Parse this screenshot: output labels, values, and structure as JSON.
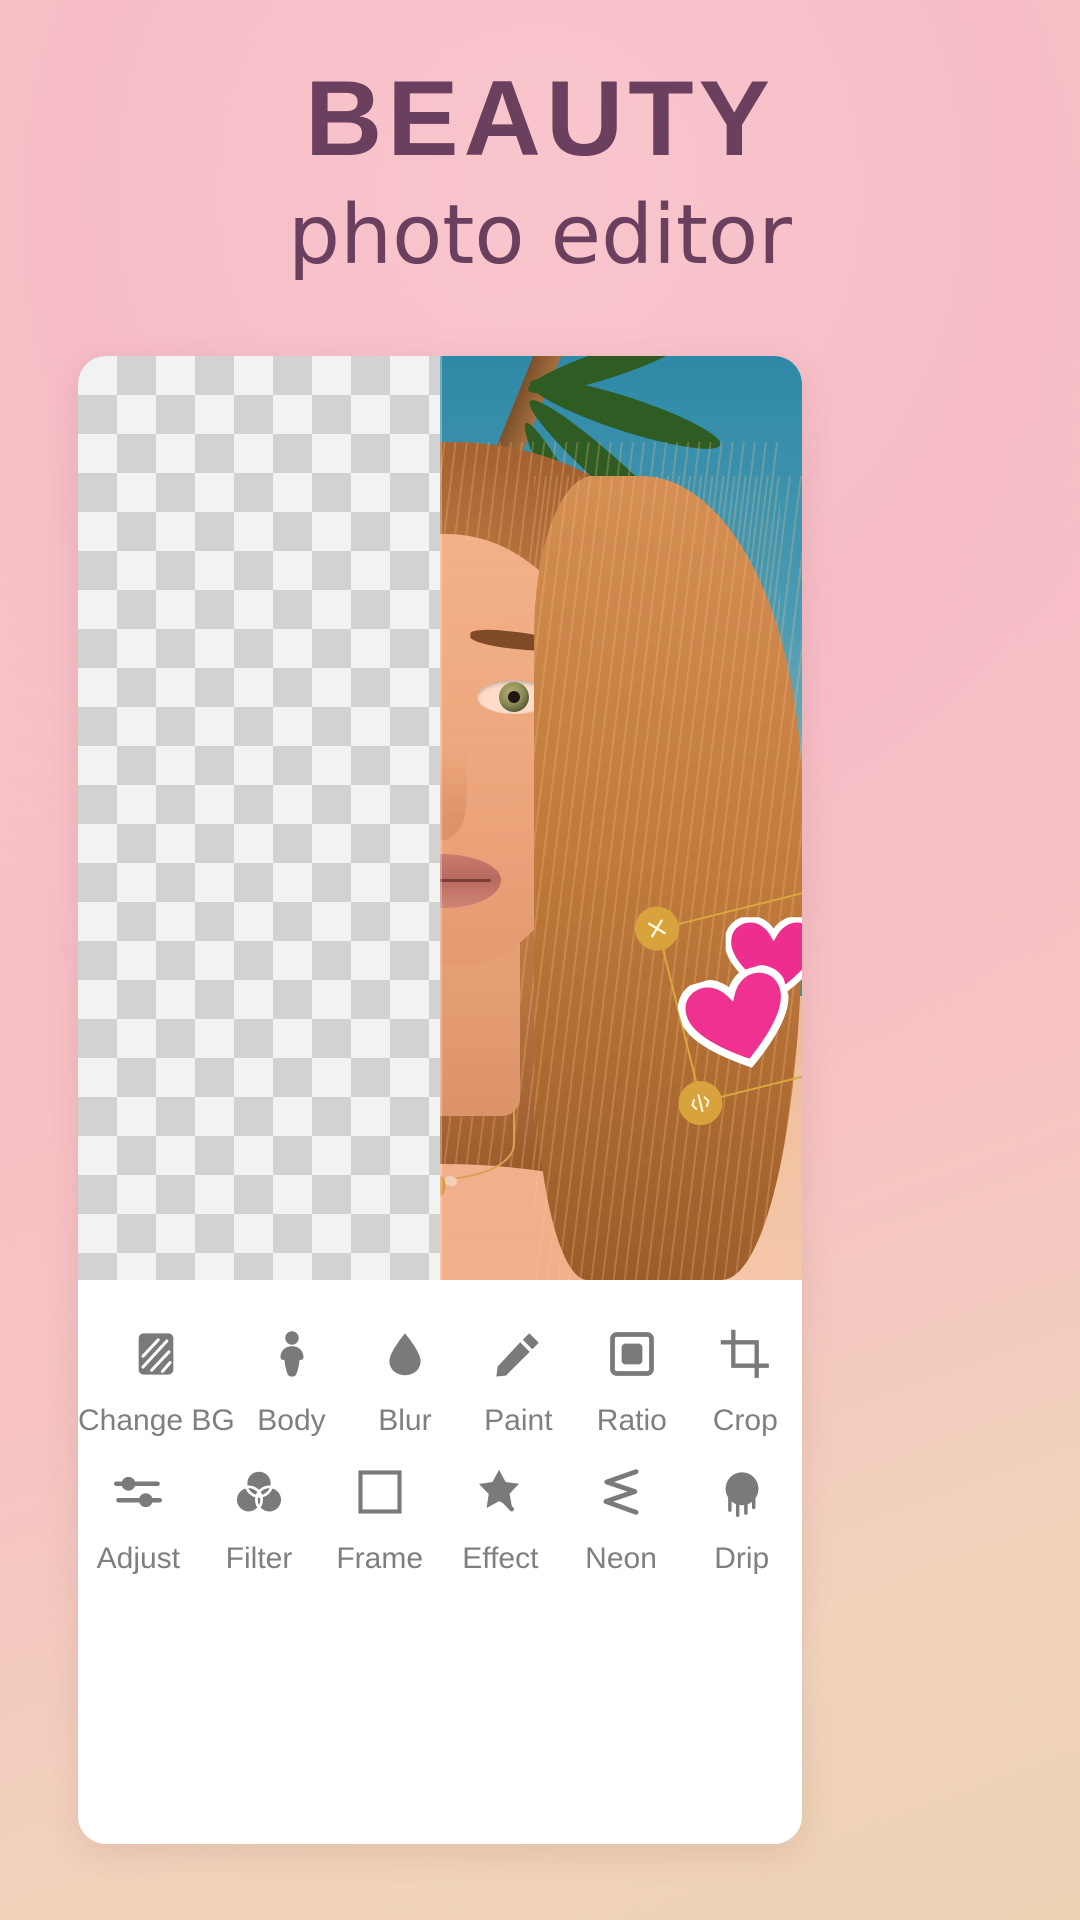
{
  "header": {
    "title": "BEAUTY",
    "subtitle": "photo editor"
  },
  "colors": {
    "title_text": "#6b3f5e",
    "bg_pink": "#f8bfc6",
    "bg_peach": "#f0d5b8",
    "toolbar_bg": "#ffffff",
    "tool_icon": "#7a7a7a",
    "tool_label": "#7f7f7f",
    "sticker_handle": "#d8a23c",
    "sticker_frame": "#d8a840",
    "heart_pink": "#ec2f8c",
    "heart_pink_light": "#f062a8"
  },
  "editor": {
    "preview": {
      "left_panel": "transparent-checkerboard",
      "right_panel": "beach-background",
      "subject": "portrait-photo"
    },
    "sticker": {
      "name": "double-heart-sticker",
      "handles": [
        {
          "name": "delete-handle",
          "icon": "close-icon",
          "position": "top-left"
        },
        {
          "name": "edit-handle",
          "icon": "pencil-icon",
          "position": "top-right"
        },
        {
          "name": "flip-handle",
          "icon": "flip-icon",
          "position": "bottom-left"
        },
        {
          "name": "rotate-resize-handle",
          "icon": "rotate-icon",
          "position": "bottom-right"
        }
      ]
    },
    "toolbar": {
      "rows": [
        [
          {
            "label": "Change BG",
            "icon": "checker-square-icon"
          },
          {
            "label": "Body",
            "icon": "body-silhouette-icon"
          },
          {
            "label": "Blur",
            "icon": "droplet-icon"
          },
          {
            "label": "Paint",
            "icon": "pencil-icon"
          },
          {
            "label": "Ratio",
            "icon": "square-in-square-icon"
          },
          {
            "label": "Crop",
            "icon": "crop-icon"
          }
        ],
        [
          {
            "label": "Adjust",
            "icon": "sliders-icon"
          },
          {
            "label": "Filter",
            "icon": "three-circles-icon"
          },
          {
            "label": "Frame",
            "icon": "square-outline-icon"
          },
          {
            "label": "Effect",
            "icon": "magic-star-icon"
          },
          {
            "label": "Neon",
            "icon": "zigzag-icon"
          },
          {
            "label": "Drip",
            "icon": "drip-blob-icon"
          }
        ]
      ]
    }
  }
}
